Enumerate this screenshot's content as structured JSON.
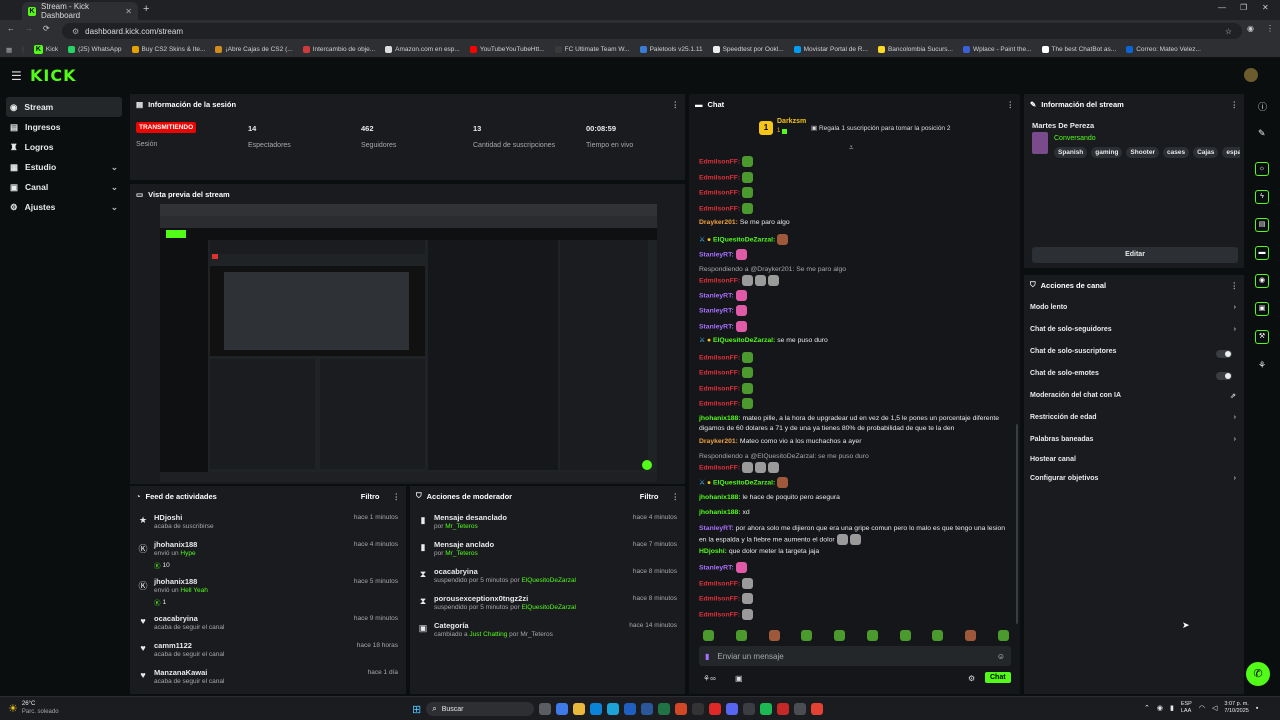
{
  "browser": {
    "tab_title": "Stream - Kick Dashboard",
    "url": "dashboard.kick.com/stream",
    "bookmarks": [
      "Kick",
      "(25) WhatsApp",
      "Buy CS2 Skins & Ite...",
      "¡Abre Cajas de CS2 (...",
      "Intercambio de obje...",
      "Amazon.com en esp...",
      "YouTubeYouTubeHtt...",
      "FC Ultimate Team W...",
      "Paletools v25.1.11",
      "Speedtest por Ookl...",
      "Movistar Portal de R...",
      "Bancolombia Sucurs...",
      "Wplace - Paint the...",
      "The best ChatBot as...",
      "Correo: Mateo Velez..."
    ]
  },
  "app": {
    "logo": "KICK",
    "nav": [
      {
        "label": "Stream",
        "icon": "broadcast-icon",
        "active": true,
        "chev": ""
      },
      {
        "label": "Ingresos",
        "icon": "money-icon",
        "chev": ""
      },
      {
        "label": "Logros",
        "icon": "trophy-icon",
        "chev": ""
      },
      {
        "label": "Estudio",
        "icon": "studio-icon",
        "chev": "⌄"
      },
      {
        "label": "Canal",
        "icon": "channel-icon",
        "chev": "⌄"
      },
      {
        "label": "Ajustes",
        "icon": "gear-icon",
        "chev": "⌄"
      }
    ]
  },
  "session": {
    "title": "Información de la sesión",
    "live_badge": "TRANSMITIENDO",
    "session_label": "Sesión",
    "stats": [
      {
        "value": "14",
        "label": "Espectadores"
      },
      {
        "value": "462",
        "label": "Seguidores"
      },
      {
        "value": "13",
        "label": "Cantidad de suscripciones"
      },
      {
        "value": "00:08:59",
        "label": "Tiempo en vivo"
      }
    ]
  },
  "preview": {
    "title": "Vista previa del stream"
  },
  "activity": {
    "title": "Feed de actividades",
    "filter": "Filtro",
    "items": [
      {
        "icon": "star-icon",
        "name": "HDjoshi",
        "sub": "acaba de suscribirse",
        "extra": "",
        "time": "hace 1 minutos"
      },
      {
        "icon": "kick-icon",
        "name": "jhohanix188",
        "sub": "envió un ",
        "sub2": "Hype",
        "extra": "10",
        "time": "hace 4 minutos"
      },
      {
        "icon": "kick-icon",
        "name": "jhohanix188",
        "sub": "envió un ",
        "sub2": "Hell Yeah",
        "extra": "1",
        "time": "hace 5 minutos"
      },
      {
        "icon": "heart-icon",
        "name": "ocacabryina",
        "sub": "acaba de seguir el canal",
        "extra": "",
        "time": "hace 9 minutos"
      },
      {
        "icon": "heart-icon",
        "name": "camm1122",
        "sub": "acaba de seguir el canal",
        "extra": "",
        "time": "hace 18 horas"
      },
      {
        "icon": "heart-icon",
        "name": "ManzanaKawai",
        "sub": "acaba de seguir el canal",
        "extra": "",
        "time": "hace 1 día"
      }
    ]
  },
  "modactions": {
    "title": "Acciones de moderador",
    "filter": "Filtro",
    "items": [
      {
        "icon": "pin-icon",
        "title": "Mensaje desanclado",
        "pre": "por ",
        "by": "Mr_Teteros",
        "post": "",
        "time": "hace 4 minutos"
      },
      {
        "icon": "pin-icon",
        "title": "Mensaje anclado",
        "pre": "por ",
        "by": "Mr_Teteros",
        "post": "",
        "time": "hace 7 minutos"
      },
      {
        "icon": "hourglass-icon",
        "title": "ocacabryina",
        "pre": "suspendido por 5 minutos por ",
        "by": "ElQuesitoDeZarzal",
        "post": "",
        "time": "hace 8 minutos"
      },
      {
        "icon": "hourglass-icon",
        "title": "porousexceptionx0tngz2zi",
        "pre": "suspendido por 5 minutos por ",
        "by": "ElQuesitoDeZarzal",
        "post": "",
        "time": "hace 8 minutos"
      },
      {
        "icon": "category-icon",
        "title": "Categoría",
        "pre": "cambiado a ",
        "by": "Just Chatting",
        "post": " por Mr_Teteros",
        "time": "hace 14 minutos"
      }
    ]
  },
  "chat": {
    "title": "Chat",
    "top_gifter": "Darkzsm",
    "top_gifter_rank": "1",
    "top_gifter_count": "1",
    "gift_text": "Regala 1 suscripción para tomar la posición 2",
    "input_placeholder": "Enviar un mensaje",
    "send_button": "Chat",
    "messages": [
      {
        "user": "EdmilsonFF:",
        "color": "#e0303a",
        "text": "",
        "emotes": [
          "pepe"
        ]
      },
      {
        "user": "EdmilsonFF:",
        "color": "#e0303a",
        "text": "",
        "emotes": [
          "pepe"
        ]
      },
      {
        "user": "EdmilsonFF:",
        "color": "#e0303a",
        "text": "",
        "emotes": [
          "pepe"
        ]
      },
      {
        "user": "EdmilsonFF:",
        "color": "#e0303a",
        "text": "",
        "emotes": [
          "pepe"
        ]
      },
      {
        "user": "Drayker201:",
        "color": "#f2a23c",
        "text": "Se me paro algo",
        "emotes": []
      },
      {
        "user": "ElQuesitoDeZarzal:",
        "color": "#53fc18",
        "text": "",
        "emotes": [
          "brown"
        ],
        "badges": true
      },
      {
        "user": "StanleyRT:",
        "color": "#a970ff",
        "text": "",
        "emotes": [
          "pink"
        ]
      },
      {
        "user": "EdmilsonFF:",
        "color": "#e0303a",
        "text": "",
        "emotes": [
          "gray",
          "gray",
          "gray"
        ],
        "reply": "Respondiendo a @Drayker201: Se me paro algo"
      },
      {
        "user": "StanleyRT:",
        "color": "#a970ff",
        "text": "",
        "emotes": [
          "pink"
        ]
      },
      {
        "user": "StanleyRT:",
        "color": "#a970ff",
        "text": "",
        "emotes": [
          "pink"
        ]
      },
      {
        "user": "StanleyRT:",
        "color": "#a970ff",
        "text": "",
        "emotes": [
          "pink"
        ]
      },
      {
        "user": "ElQuesitoDeZarzal:",
        "color": "#53fc18",
        "text": "se me puso duro",
        "emotes": [],
        "badges": true
      },
      {
        "user": "EdmilsonFF:",
        "color": "#e0303a",
        "text": "",
        "emotes": [
          "pepe"
        ]
      },
      {
        "user": "EdmilsonFF:",
        "color": "#e0303a",
        "text": "",
        "emotes": [
          "pepe"
        ]
      },
      {
        "user": "EdmilsonFF:",
        "color": "#e0303a",
        "text": "",
        "emotes": [
          "pepe"
        ]
      },
      {
        "user": "EdmilsonFF:",
        "color": "#e0303a",
        "text": "",
        "emotes": [
          "pepe"
        ]
      },
      {
        "user": "jhohanix188:",
        "color": "#53fc18",
        "text": "mateo pille, a la hora de upgradear ud en vez de 1,5 le pones un porcentaje diferente digamos de 60 dolares a 71 y de una ya tienes 80% de probabilidad de que te la den",
        "emotes": [],
        "two": true
      },
      {
        "user": "Drayker201:",
        "color": "#f2a23c",
        "text": "Mateo como vio a los muchachos a ayer",
        "emotes": []
      },
      {
        "user": "EdmilsonFF:",
        "color": "#e0303a",
        "text": "",
        "emotes": [
          "gray",
          "gray",
          "gray"
        ],
        "reply": "Respondiendo a @ElQuesitoDeZarzal: se me puso duro"
      },
      {
        "user": "ElQuesitoDeZarzal:",
        "color": "#53fc18",
        "text": "",
        "emotes": [
          "brown"
        ],
        "badges": true
      },
      {
        "user": "jhohanix188:",
        "color": "#53fc18",
        "text": "le hace de poquito pero asegura",
        "emotes": []
      },
      {
        "user": "jhohanix188:",
        "color": "#53fc18",
        "text": "xd",
        "emotes": []
      },
      {
        "user": "StanleyRT:",
        "color": "#a970ff",
        "text": "por ahora solo me dijieron que era una gripe comun pero lo malo es que tengo una lesion en la espalda y la fiebre me aumento el dolor",
        "emotes": [
          "gray",
          "gray"
        ],
        "two": true
      },
      {
        "user": "HDjoshi:",
        "color": "#53fc18",
        "text": "que dolor meter la targeta jaja",
        "emotes": []
      },
      {
        "user": "StanleyRT:",
        "color": "#a970ff",
        "text": "",
        "emotes": [
          "pink"
        ]
      },
      {
        "user": "EdmilsonFF:",
        "color": "#e0303a",
        "text": "",
        "emotes": [
          "gray"
        ]
      },
      {
        "user": "EdmilsonFF:",
        "color": "#e0303a",
        "text": "",
        "emotes": [
          "gray"
        ]
      },
      {
        "user": "EdmilsonFF:",
        "color": "#e0303a",
        "text": "",
        "emotes": [
          "gray"
        ]
      }
    ]
  },
  "streaminfo": {
    "title": "Información del stream",
    "stream_title": "Martes De Pereza",
    "category": "Conversando",
    "tags": [
      "Spanish",
      "gaming",
      "Shooter",
      "cases",
      "Cajas",
      "españ"
    ],
    "edit_button": "Editar"
  },
  "channelactions": {
    "title": "Acciones de canal",
    "items": [
      {
        "label": "Modo lento",
        "control": "arrow"
      },
      {
        "label": "Chat de solo-seguidores",
        "control": "arrow"
      },
      {
        "label": "Chat de solo-suscriptores",
        "control": "toggle"
      },
      {
        "label": "Chat de solo-emotes",
        "control": "toggle"
      },
      {
        "label": "Moderación del chat con IA",
        "control": "external"
      },
      {
        "label": "Restricción de edad",
        "control": "arrow"
      },
      {
        "label": "Palabras baneadas",
        "control": "arrow"
      },
      {
        "label": "Hostear canal",
        "control": "none"
      },
      {
        "label": "Configurar objetivos",
        "control": "arrow"
      }
    ]
  },
  "taskbar": {
    "weather_temp": "26°C",
    "weather_text": "Parc. soleado",
    "search": "Buscar",
    "lang": "ESP",
    "lang2": "LAA",
    "time": "3:07 p. m.",
    "date": "7/10/2025"
  }
}
